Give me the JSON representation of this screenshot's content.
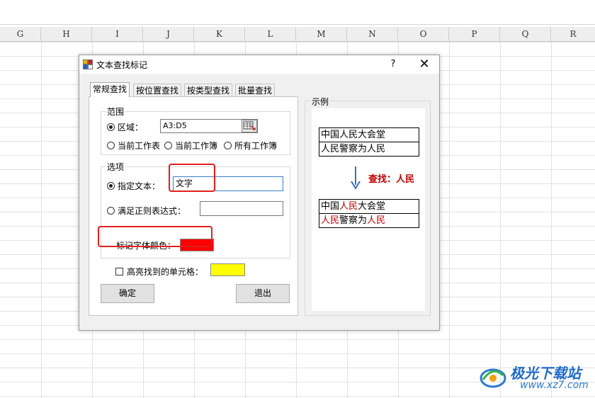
{
  "spreadsheet": {
    "columns": [
      "G",
      "H",
      "I",
      "J",
      "K",
      "L",
      "M",
      "N",
      "O",
      "P",
      "Q",
      "R"
    ]
  },
  "dialog": {
    "title": "文本查找标记",
    "help_label": "?",
    "close_label": "✕",
    "tabs": [
      {
        "label": "常规查找",
        "active": true
      },
      {
        "label": "按位置查找",
        "active": false
      },
      {
        "label": "按类型查找",
        "active": false
      },
      {
        "label": "批量查找",
        "active": false
      }
    ],
    "range": {
      "legend": "范围",
      "area_label": "区域：",
      "area_value": "A3:D5",
      "area_selected": true,
      "options": [
        "当前工作表",
        "当前工作簿",
        "所有工作簿"
      ]
    },
    "options": {
      "legend": "选项",
      "specified_text_label": "指定文本：",
      "specified_text_value": "文字",
      "specified_text_selected": true,
      "regex_label": "满足正则表达式：",
      "regex_value": "",
      "mark_color_label": "标记字体颜色：",
      "mark_color": "#ff0000"
    },
    "highlight": {
      "label": "高亮找到的单元格：",
      "checked": false,
      "color": "#ffff00"
    },
    "ok_label": "确定",
    "exit_label": "退出",
    "example": {
      "legend": "示例",
      "before_rows": [
        "中国人民大会堂",
        "人民警察为人民"
      ],
      "find_label": "查找：人民",
      "after_rows": [
        [
          {
            "t": "中国",
            "hl": false
          },
          {
            "t": "人民",
            "hl": true
          },
          {
            "t": "大会堂",
            "hl": false
          }
        ],
        [
          {
            "t": "人民",
            "hl": true
          },
          {
            "t": "警察为",
            "hl": false
          },
          {
            "t": "人民",
            "hl": true
          }
        ]
      ],
      "highlight_color": "#c00000"
    }
  },
  "watermark": {
    "name": "极光下载站",
    "url": "www.xz7.com"
  }
}
